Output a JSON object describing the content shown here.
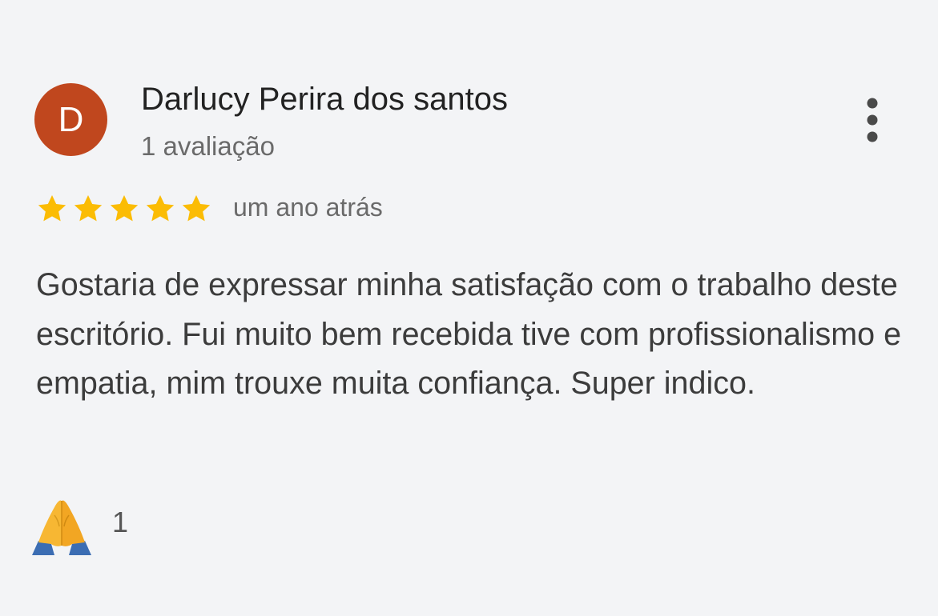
{
  "review": {
    "avatar_initial": "D",
    "avatar_color": "#c0471e",
    "author_name": "Darlucy Perira dos santos",
    "review_count": "1 avaliação",
    "rating": 5,
    "rating_max": 5,
    "star_color": "#fbbc04",
    "time_ago": "um ano atrás",
    "text": "Gostaria de expressar minha satisfação com o trabalho deste escritório. Fui muito bem recebida tive com profissionalismo e empatia, mim trouxe muita confiança. Super indico.",
    "more_icon": "more-vert-icon",
    "reaction": {
      "icon": "praying-hands-icon",
      "count": "1"
    }
  }
}
